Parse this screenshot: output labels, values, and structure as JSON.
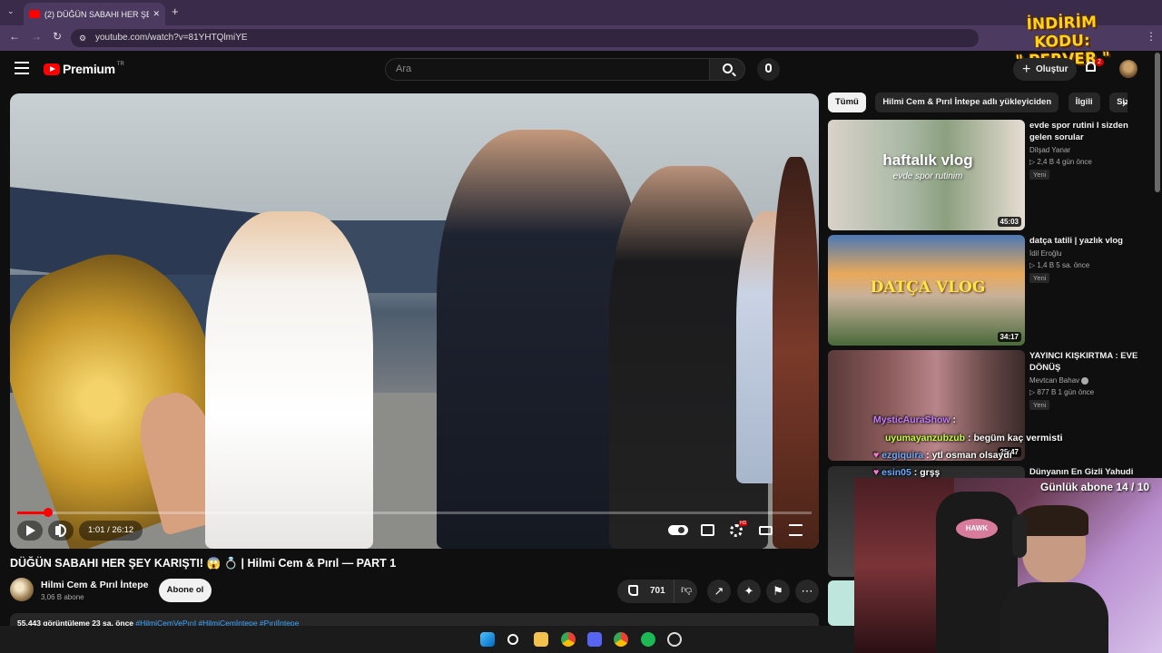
{
  "browser": {
    "tab_title": "(2) DÜĞÜN SABAHI HER ŞEY KA",
    "url": "youtube.com/watch?v=81YHTQlmiYE"
  },
  "promo": {
    "line1": "İNDİRİM KODU:",
    "line2": "\" PERVER \""
  },
  "header": {
    "logo_text": "Premium",
    "logo_region": "TR",
    "search_placeholder": "Ara",
    "create_label": "Oluştur",
    "notification_count": "2"
  },
  "player": {
    "current_time": "1:01",
    "duration": "26:12",
    "time_display": "1:01 / 26:12",
    "progress_fraction": 0.039
  },
  "video": {
    "title": "DÜĞÜN SABAHI HER ŞEY KARIŞTI! 😱 💍  | Hilmi Cem & Pırıl — PART 1",
    "channel_name": "Hilmi Cem & Pırıl İntepe",
    "subscribers": "3,06 B abone",
    "subscribe_label": "Abone ol",
    "likes": "701",
    "views_line": "55.443 görüntüleme  23 sa. önce",
    "tags": "#HilmiCemVePırıl #HilmiCemİntepe #Pırılİntepe"
  },
  "chips": [
    "Tümü",
    "Hilmi Cem & Pırıl İntepe adlı yükleyiciden",
    "İlgili",
    "Size ö"
  ],
  "recommendations": [
    {
      "title": "evde spor rutini I sizden gelen sorular",
      "channel": "Dilşad Yanar",
      "meta": "▷ 2,4 B   4 gün önce",
      "badge": "Yeni",
      "duration": "45:03",
      "overlay_title": "haftalık vlog",
      "overlay_sub": "evde spor rutinim"
    },
    {
      "title": "datça tatili | yazlık vlog",
      "channel": "İdil Eroğlu",
      "meta": "▷ 1,4 B   5 sa. önce",
      "badge": "Yeni",
      "duration": "34:17",
      "overlay_title": "DATÇA VLOG"
    },
    {
      "title": "YAYINCI KIŞKIRTMA : EVE DÖNÜŞ",
      "channel": "Mevtcan Bahav",
      "meta": "▷ 877 B   1 gün önce",
      "badge": "Yeni",
      "duration": "25:47"
    },
    {
      "title": "Dünyanın En Gizli Yahudi"
    }
  ],
  "stream": {
    "sub_goal": "Günlük abone 14 / 10",
    "chair_brand": "HAWK",
    "chat": [
      {
        "user": "MysticAuraShow",
        "text": ""
      },
      {
        "user": "uyumayanzubzub",
        "text": "begüm kaç vermisti"
      },
      {
        "user": "ezgiquira",
        "text": "ytl osman olsaydı"
      },
      {
        "user": "esin05",
        "text": "grşş"
      }
    ]
  },
  "colors": {
    "accent_red": "#ff0000",
    "chrome_purple": "#4d3a60",
    "promo_yellow": "#ffd21a"
  }
}
